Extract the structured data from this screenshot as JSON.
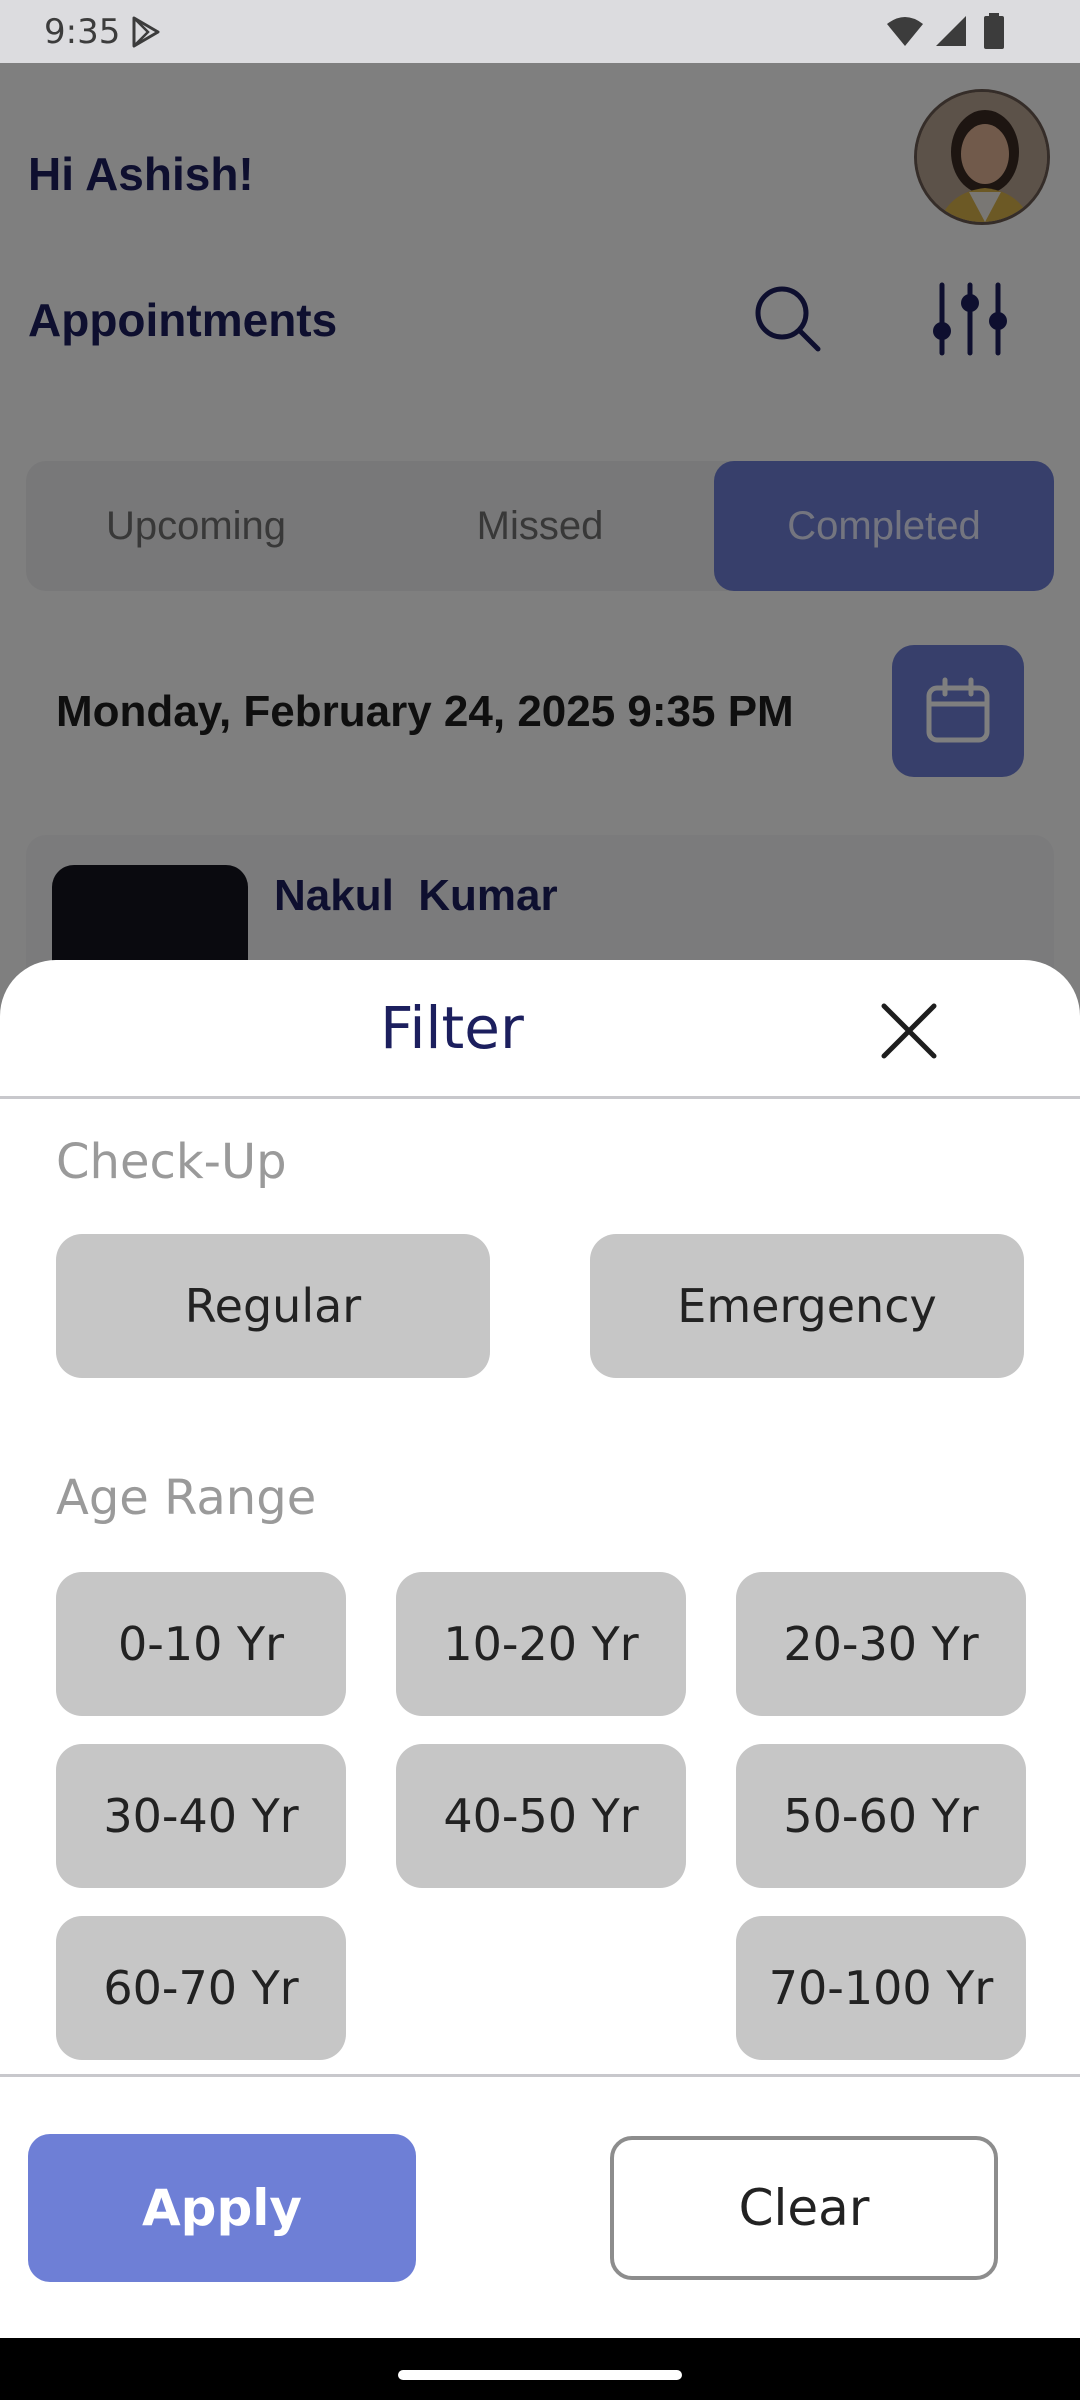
{
  "status_bar": {
    "time": "9:35",
    "icons": [
      "play-store-icon",
      "wifi-icon",
      "signal-icon",
      "battery-icon"
    ]
  },
  "header": {
    "greeting": "Hi Ashish!",
    "section_title": "Appointments",
    "icons": [
      "search-icon",
      "tune-icon"
    ]
  },
  "tabs": [
    {
      "label": "Upcoming",
      "selected": false
    },
    {
      "label": "Missed",
      "selected": false
    },
    {
      "label": "Completed",
      "selected": true
    }
  ],
  "date_time": "Monday, February 24, 2025 9:35 PM",
  "appointment_card": {
    "name": "Nakul  Kumar"
  },
  "filter_sheet": {
    "title": "Filter",
    "checkup": {
      "label": "Check-Up",
      "options": [
        "Regular",
        "Emergency"
      ]
    },
    "age_range": {
      "label": "Age Range",
      "options": [
        "0-10 Yr",
        "10-20 Yr",
        "20-30 Yr",
        "30-40 Yr",
        "40-50 Yr",
        "50-60 Yr",
        "60-70 Yr",
        "70-100 Yr"
      ]
    },
    "apply_label": "Apply",
    "clear_label": "Clear"
  },
  "colors": {
    "accent": "#6e7fd6",
    "title_navy": "#1c1f5e",
    "chip_bg": "#c6c6c6",
    "section_label": "#9a9a9a"
  }
}
